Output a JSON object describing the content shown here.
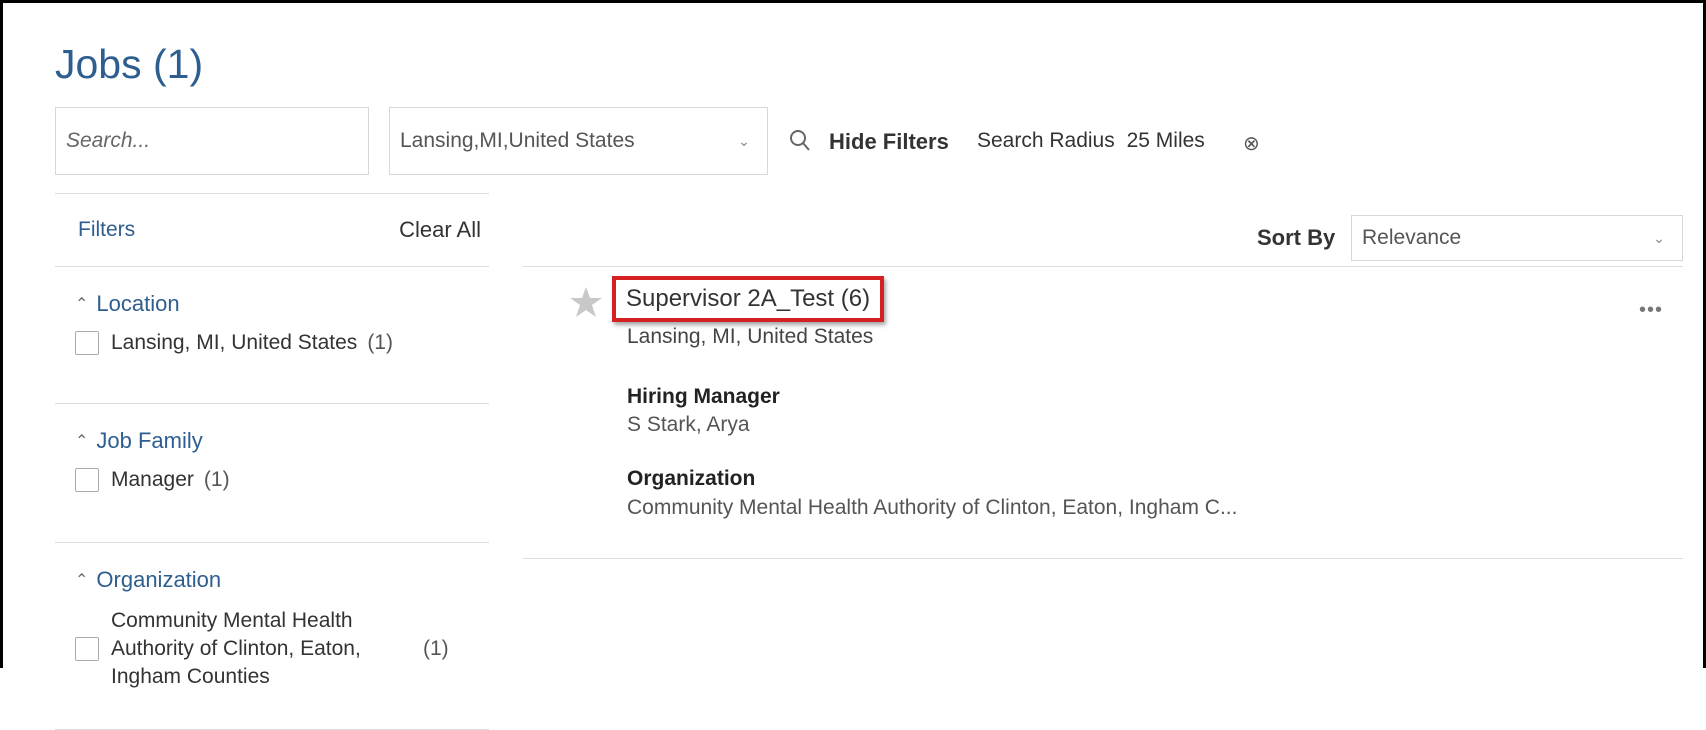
{
  "page": {
    "title": "Jobs (1)"
  },
  "search": {
    "placeholder": "Search...",
    "location_value": "Lansing,MI,United States",
    "hide_filters_label": "Hide Filters",
    "radius_label": "Search Radius",
    "radius_value": "25 Miles"
  },
  "filters": {
    "title": "Filters",
    "clear_all": "Clear All",
    "facets": [
      {
        "title": "Location",
        "options": [
          {
            "label": "Lansing, MI, United States",
            "count": "(1)"
          }
        ]
      },
      {
        "title": "Job Family",
        "options": [
          {
            "label": "Manager",
            "count": "(1)"
          }
        ]
      },
      {
        "title": "Organization",
        "options": [
          {
            "label": "Community Mental Health Authority of Clinton, Eaton, Ingham Counties",
            "count": "(1)"
          }
        ]
      }
    ]
  },
  "sort": {
    "label": "Sort By",
    "value": "Relevance"
  },
  "results": [
    {
      "title": "Supervisor 2A_Test (6)",
      "location": "Lansing, MI, United States",
      "hiring_manager_label": "Hiring Manager",
      "hiring_manager": "S Stark, Arya",
      "organization_label": "Organization",
      "organization": "Community Mental Health Authority of Clinton, Eaton, Ingham C..."
    }
  ],
  "icons": {
    "search": "search-icon",
    "star": "star-icon",
    "more": "more-icon",
    "chevron": "chevron-down-icon",
    "caret": "chevron-up-icon",
    "clear": "clear-circle-icon"
  },
  "colors": {
    "link_blue": "#2e5e8f",
    "highlight_red": "#d42020",
    "star_gray": "#c8c8c8"
  }
}
